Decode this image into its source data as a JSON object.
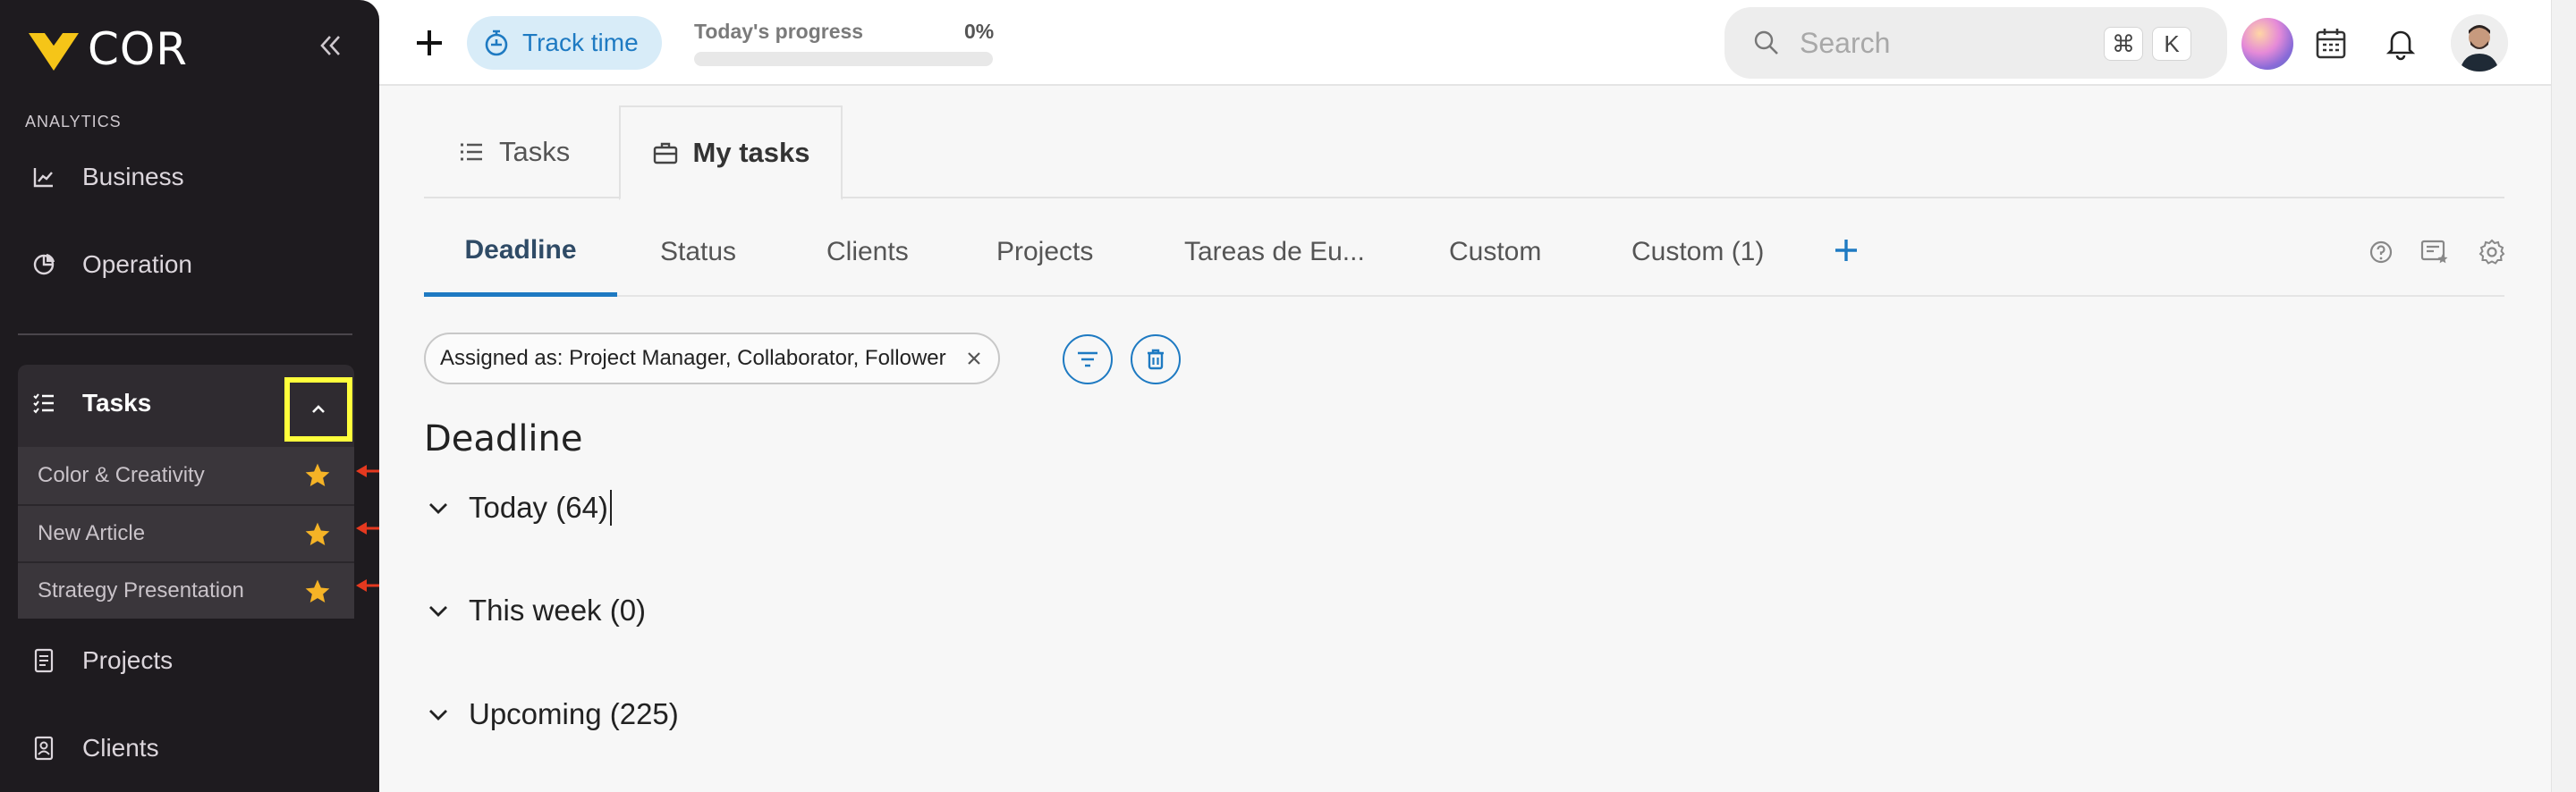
{
  "sidebar": {
    "logo_text": "COR",
    "section_label": "ANALYTICS",
    "items_top": [
      {
        "label": "Business",
        "icon": "chart-line-icon"
      },
      {
        "label": "Operation",
        "icon": "pie-chart-icon"
      }
    ],
    "tasks": {
      "label": "Tasks",
      "subitems": [
        {
          "label": "Color & Creativity",
          "starred": true
        },
        {
          "label": "New Article",
          "starred": true
        },
        {
          "label": "Strategy Presentation",
          "starred": true
        }
      ]
    },
    "items_bottom": [
      {
        "label": "Projects",
        "icon": "document-icon"
      },
      {
        "label": "Clients",
        "icon": "contact-card-icon"
      }
    ]
  },
  "topbar": {
    "track_time_label": "Track time",
    "progress_label": "Today's progress",
    "progress_value": "0%",
    "progress_fraction": 0,
    "search_placeholder": "Search",
    "shortcut_keys": [
      "⌘",
      "K"
    ]
  },
  "main": {
    "view_tabs": [
      {
        "label": "Tasks",
        "icon": "list-icon"
      },
      {
        "label": "My tasks",
        "icon": "briefcase-icon",
        "active": true
      }
    ],
    "sub_tabs": [
      {
        "label": "Deadline",
        "active": true
      },
      {
        "label": "Status"
      },
      {
        "label": "Clients"
      },
      {
        "label": "Projects"
      },
      {
        "label": "Tareas de Eu..."
      },
      {
        "label": "Custom"
      },
      {
        "label": "Custom (1)"
      }
    ],
    "filter_chip": "Assigned as: Project Manager, Collaborator, Follower",
    "section_title": "Deadline",
    "groups": [
      {
        "label": "Today (64)"
      },
      {
        "label": "This week (0)"
      },
      {
        "label": "Upcoming (225)"
      }
    ]
  },
  "colors": {
    "accent": "#1e7ac2",
    "sidebar_bg": "#1e1b1f",
    "highlight": "#ffff3b",
    "star": "#f5b326",
    "annotation_arrow": "#e5391f"
  }
}
